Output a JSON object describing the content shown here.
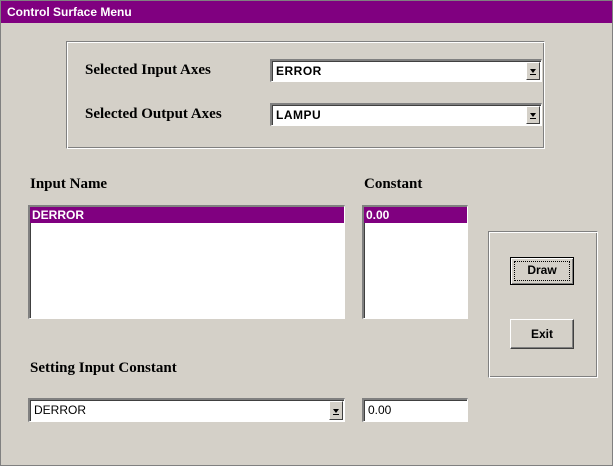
{
  "window": {
    "title": "Control Surface Menu"
  },
  "axes": {
    "input_label": "Selected Input Axes",
    "input_value": "ERROR",
    "output_label": "Selected Output Axes",
    "output_value": "LAMPU"
  },
  "inputs": {
    "name_header": "Input Name",
    "constant_header": "Constant",
    "names": [
      "DERROR"
    ],
    "constants": [
      "0.00"
    ]
  },
  "setting": {
    "label": "Setting Input Constant",
    "selected_input": "DERROR",
    "constant_value": "0.00"
  },
  "buttons": {
    "draw": "Draw",
    "exit": "Exit"
  },
  "colors": {
    "title_bar": "#800080",
    "selection": "#800080",
    "face": "#d4d0c8"
  }
}
